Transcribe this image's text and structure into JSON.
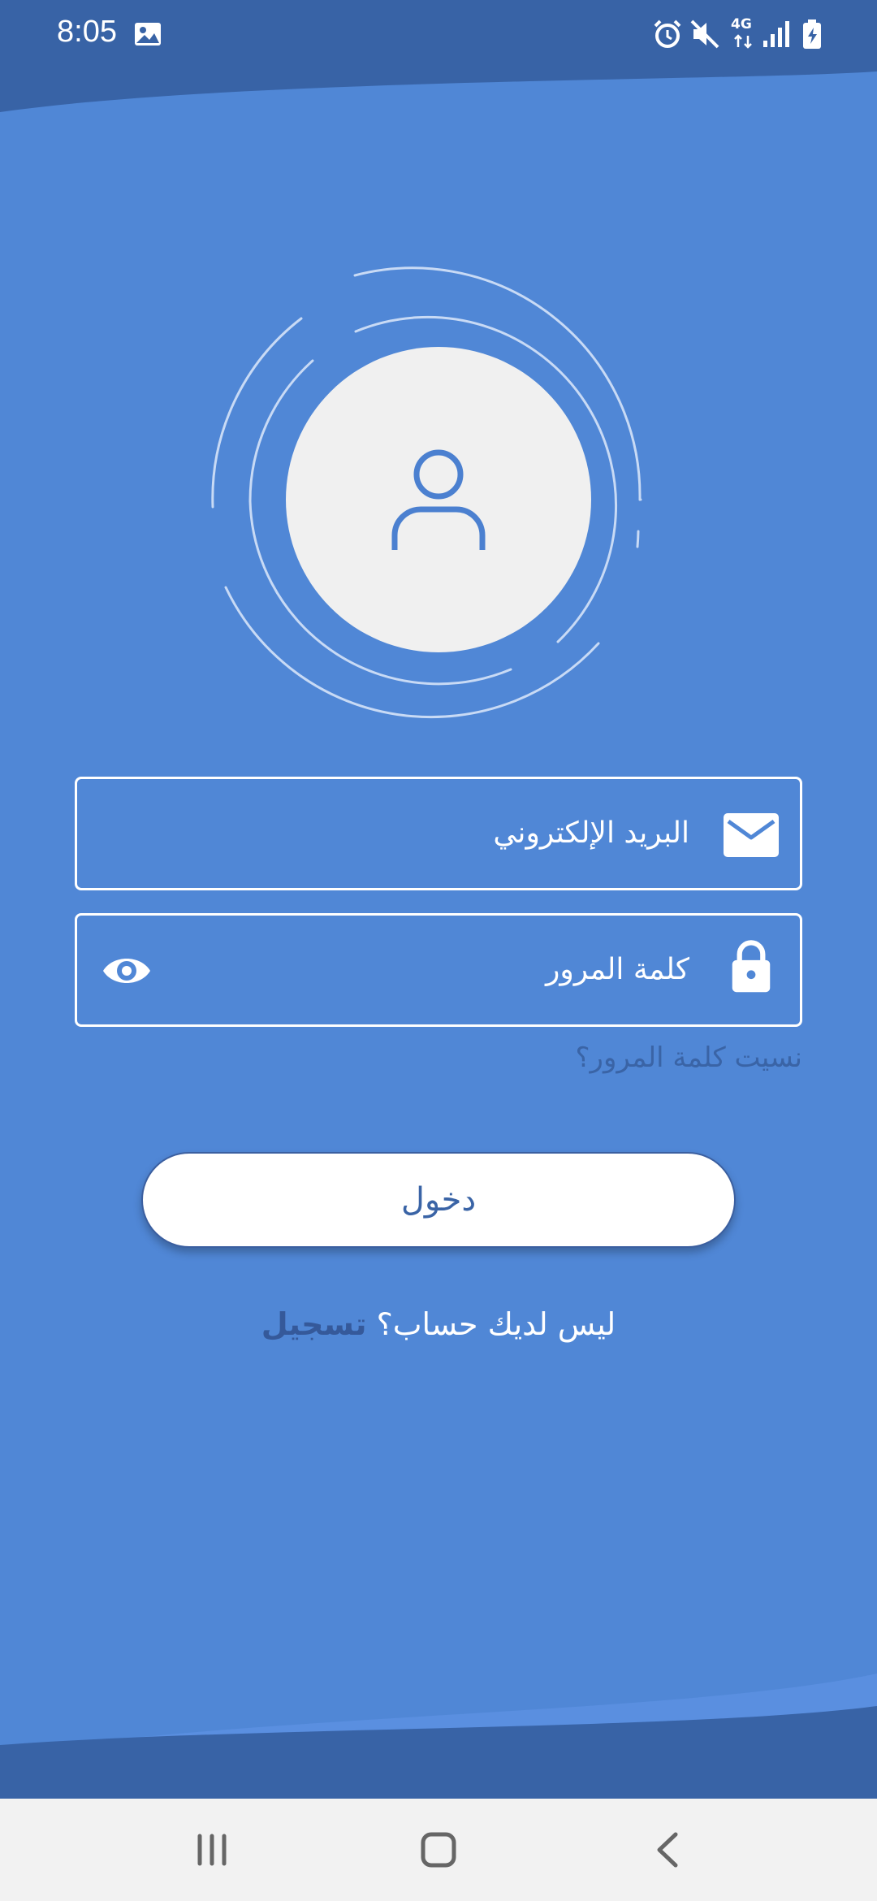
{
  "status_bar": {
    "time": "8:05",
    "network": "4G",
    "icons": [
      "image-icon",
      "alarm-icon",
      "mute-icon",
      "network-4g-icon",
      "signal-icon",
      "battery-charging-icon"
    ]
  },
  "avatar": {
    "icon": "user-icon"
  },
  "form": {
    "email_placeholder": "البريد الإلكتروني",
    "email_icon": "envelope-icon",
    "password_placeholder": "كلمة المرور",
    "password_icon": "lock-icon",
    "visibility_icon": "eye-icon",
    "forgot_password": "نسيت كلمة المرور؟",
    "login_label": "دخول",
    "no_account_text": "ليس لديك حساب؟",
    "register_label": "تسجيل"
  },
  "nav_bar": {
    "icons": [
      "recent-apps-icon",
      "home-icon",
      "back-icon"
    ]
  },
  "colors": {
    "background": "#5087d6",
    "header_band": "#3863a6",
    "accent_text": "#3a64a6",
    "avatar_circle": "#f0f0f0"
  }
}
